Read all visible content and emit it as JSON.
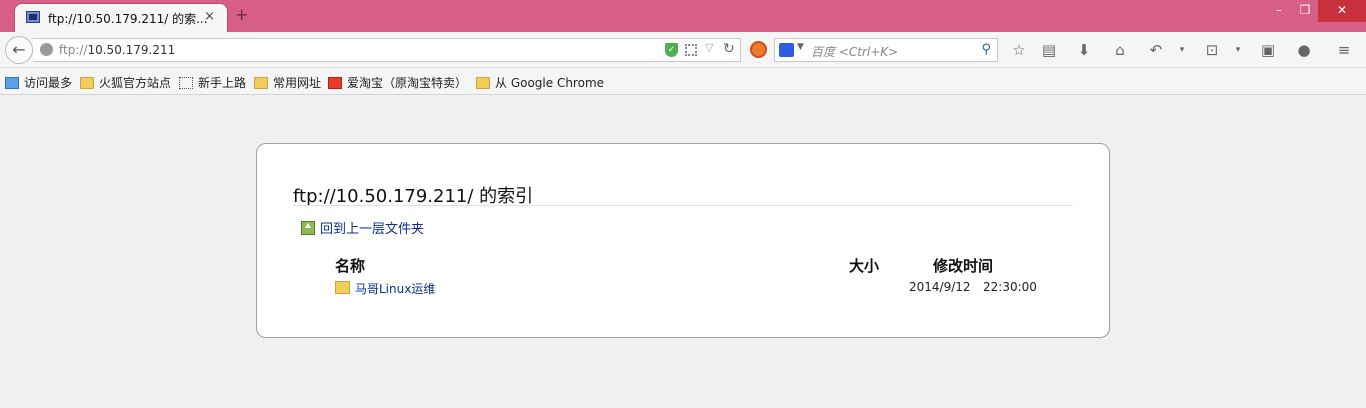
{
  "browser": {
    "tab_title": "ftp://10.50.179.211/ 的索...",
    "tab_close": "×",
    "new_tab": "+",
    "url_scheme": "ftp://",
    "url_host": "10.50.179.211",
    "search_placeholder": "百度 <Ctrl+K>",
    "window_controls": {
      "minimize": "–",
      "maximize": "❐",
      "close": "✕"
    }
  },
  "bookmarks": [
    {
      "label": "访问最多",
      "icon": "most-visited-icon"
    },
    {
      "label": "火狐官方站点",
      "icon": "folder-icon"
    },
    {
      "label": "新手上路",
      "icon": "page-icon"
    },
    {
      "label": "常用网址",
      "icon": "folder-icon"
    },
    {
      "label": "爱淘宝（原淘宝特卖）",
      "icon": "taobao-icon"
    },
    {
      "label": "从 Google Chrome",
      "icon": "folder-icon"
    }
  ],
  "listing": {
    "title": "ftp://10.50.179.211/ 的索引",
    "up_link": "回到上一层文件夹",
    "columns": {
      "name": "名称",
      "size": "大小",
      "modified": "修改时间"
    },
    "rows": [
      {
        "name": "马哥Linux运维",
        "size": "",
        "date": "2014/9/12",
        "time": "22:30:00"
      }
    ]
  },
  "colors": {
    "titlebar": "#d75f86",
    "link": "#0b2f8e"
  }
}
